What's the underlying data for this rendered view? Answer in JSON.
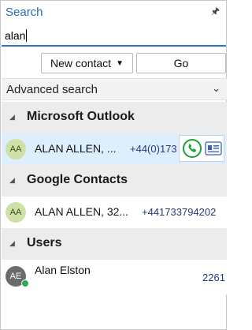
{
  "panel": {
    "title": "Search",
    "pin_icon": "pin-icon"
  },
  "search": {
    "value": "alan"
  },
  "buttons": {
    "new_contact": "New contact",
    "go": "Go"
  },
  "advanced": {
    "label": "Advanced search"
  },
  "groups": [
    {
      "title": "Microsoft Outlook",
      "items": [
        {
          "initials": "AA",
          "name": "ALAN ALLEN, ...",
          "number": "+44(0)173"
        }
      ]
    },
    {
      "title": "Google Contacts",
      "items": [
        {
          "initials": "AA",
          "name": "ALAN ALLEN, 32...",
          "number": "+441733794202"
        }
      ]
    },
    {
      "title": "Users",
      "items": [
        {
          "initials": "AE",
          "name": "Alan Elston",
          "number": "2261"
        }
      ]
    }
  ],
  "colors": {
    "accent": "#2b6cb0",
    "selected_row": "#ddeefe",
    "avatar_green": "#cfe1a6",
    "call_green": "#1aa13a"
  }
}
